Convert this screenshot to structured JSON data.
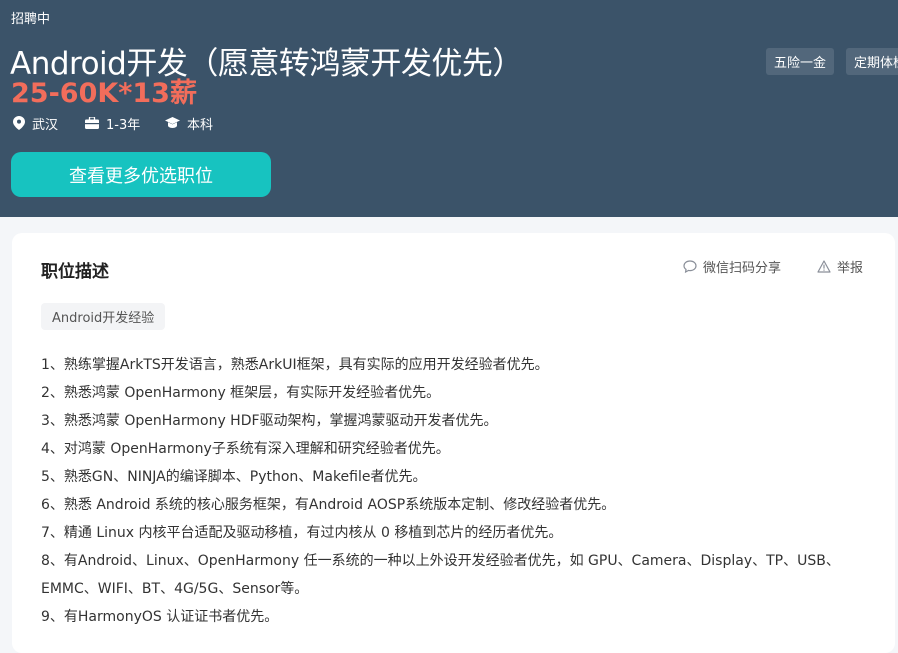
{
  "header": {
    "status": "招聘中",
    "job_title": "Android开发（愿意转鸿蒙开发优先）",
    "salary": "25-60K*13薪",
    "location": "武汉",
    "experience": "1-3年",
    "education": "本科",
    "cta_label": "查看更多优选职位",
    "benefit_tags": [
      "五险一金",
      "定期体检"
    ]
  },
  "job": {
    "section_title": "职位描述",
    "share_label": "微信扫码分享",
    "report_label": "举报",
    "skill_tag": "Android开发经验",
    "requirements": [
      "1、熟练掌握ArkTS开发语言，熟悉ArkUI框架，具有实际的应用开发经验者优先。",
      "2、熟悉鸿蒙 OpenHarmony 框架层，有实际开发经验者优先。",
      "3、熟悉鸿蒙 OpenHarmony HDF驱动架构，掌握鸿蒙驱动开发者优先。",
      "4、对鸿蒙 OpenHarmony子系统有深入理解和研究经验者优先。",
      "5、熟悉GN、NINJA的编译脚本、Python、Makefile者优先。",
      "6、熟悉 Android 系统的核心服务框架，有Android AOSP系统版本定制、修改经验者优先。",
      "7、精通 Linux 内核平台适配及驱动移植，有过内核从 0 移植到芯片的经历者优先。",
      "8、有Android、Linux、OpenHarmony 任一系统的一种以上外设开发经验者优先，如 GPU、Camera、Display、TP、USB、",
      "EMMC、WIFI、BT、4G/5G、Sensor等。",
      "9、有HarmonyOS 认证证书者优先。"
    ]
  },
  "colors": {
    "hero_bg": "#3b5369",
    "salary": "#f26d5b",
    "cta_bg": "#17c3c0"
  },
  "icons": [
    "location-pin-icon",
    "briefcase-icon",
    "graduation-cap-icon",
    "chat-bubble-icon",
    "warning-icon"
  ]
}
